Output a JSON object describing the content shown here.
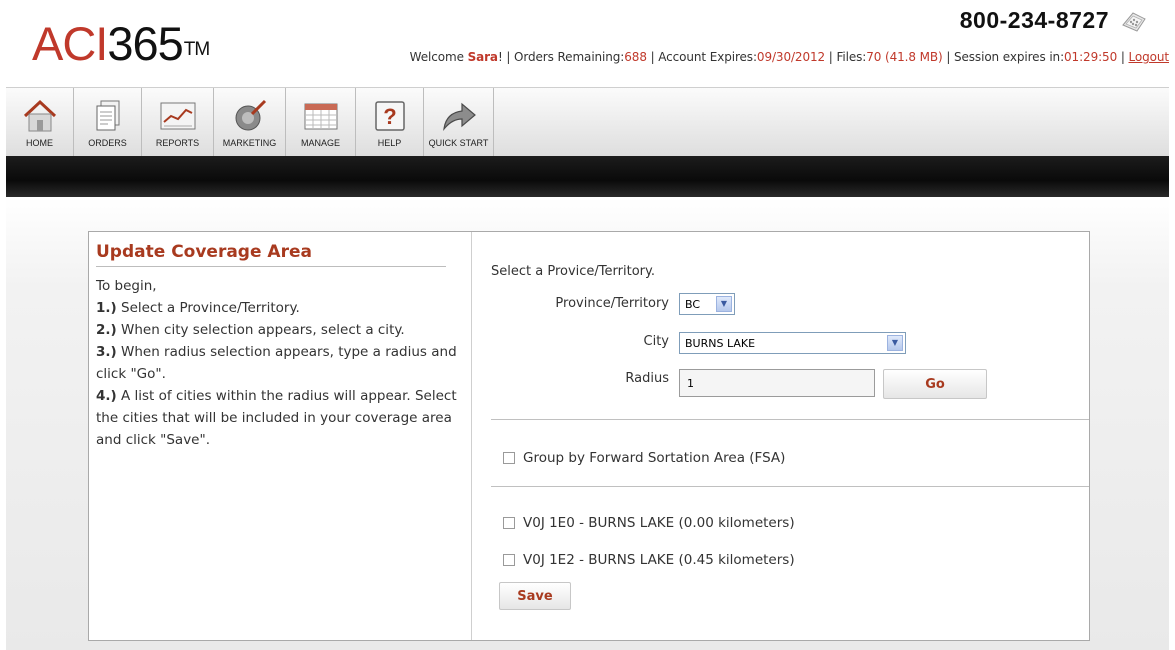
{
  "header": {
    "logo_text": "ACI",
    "logo_num": "365",
    "logo_tm": "TM",
    "phone": "800-234-8727",
    "status": {
      "welcome_prefix": "Welcome ",
      "user": "Sara",
      "welcome_suffix": "! | Orders Remaining:",
      "orders_remaining": "688",
      "account_expires_label": " | Account Expires:",
      "account_expires": "09/30/2012",
      "files_label": " | Files:",
      "files": "70 (41.8 MB)",
      "session_label": " | Session expires in:",
      "session": "01:29:50",
      "sep": " | ",
      "logout": "Logout"
    }
  },
  "nav": {
    "items": [
      {
        "label": "HOME",
        "icon": "home-icon"
      },
      {
        "label": "ORDERS",
        "icon": "orders-icon"
      },
      {
        "label": "REPORTS",
        "icon": "reports-icon"
      },
      {
        "label": "MARKETING",
        "icon": "marketing-icon"
      },
      {
        "label": "MANAGE",
        "icon": "manage-icon"
      },
      {
        "label": "HELP",
        "icon": "help-icon"
      },
      {
        "label": "QUICK START",
        "icon": "quick-start-icon"
      }
    ]
  },
  "panel": {
    "title": "Update Coverage Area",
    "intro": "To begin,",
    "steps": [
      {
        "num": "1.)",
        "text": " Select a Province/Territory."
      },
      {
        "num": "2.)",
        "text": " When city selection appears, select a city."
      },
      {
        "num": "3.)",
        "text": " When radius selection appears, type a radius and click \"Go\"."
      },
      {
        "num": "4.)",
        "text": " A list of cities within the radius will appear. Select the cities that will be included in your coverage area and click \"Save\"."
      }
    ]
  },
  "form": {
    "select_prompt": "Select a Provice/Territory.",
    "province_label": "Province/Territory",
    "province_value": "BC",
    "city_label": "City",
    "city_value": "BURNS LAKE",
    "radius_label": "Radius",
    "radius_value": "1",
    "go_label": "Go",
    "group_label": "Group by Forward Sortation Area (FSA)",
    "results": [
      "V0J 1E0 - BURNS LAKE (0.00 kilometers)",
      "V0J 1E2 - BURNS LAKE (0.45 kilometers)"
    ],
    "save_label": "Save"
  },
  "colors": {
    "accent": "#c0392b",
    "title": "#a83a1f",
    "blackbar": "#111111"
  }
}
